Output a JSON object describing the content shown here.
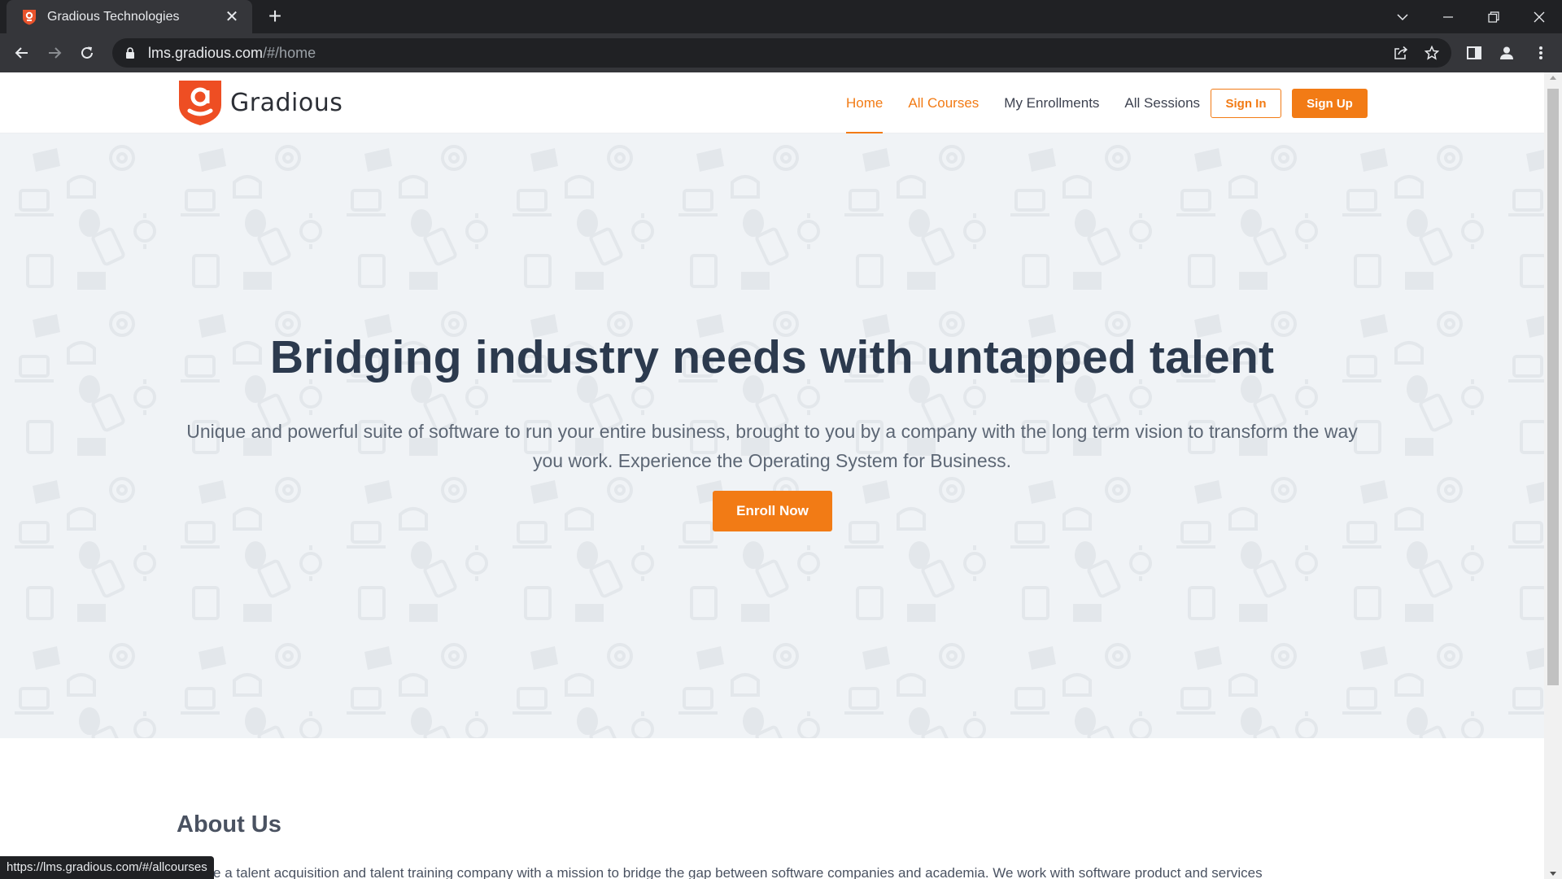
{
  "browser": {
    "tab_title": "Gradious Technologies",
    "url_host": "lms.gradious.com",
    "url_path": "/#/home",
    "status_url": "https://lms.gradious.com/#/allcourses"
  },
  "site": {
    "brand": "Gradious",
    "nav": {
      "home": "Home",
      "all_courses": "All Courses",
      "my_enrollments": "My Enrollments",
      "all_sessions": "All Sessions"
    },
    "sign_in": "Sign In",
    "sign_up": "Sign Up",
    "accent_color": "#f27b15"
  },
  "hero": {
    "title": "Bridging industry needs with untapped talent",
    "subtitle": "Unique and powerful suite of software to run your entire business, brought to you by a company with the long term vision to transform the way you work. Experience the Operating System for Business.",
    "cta": "Enroll Now"
  },
  "about": {
    "title": "About Us",
    "text": "We are a talent acquisition and talent training company with a mission to bridge the gap between software companies and academia. We work with software product and services"
  }
}
